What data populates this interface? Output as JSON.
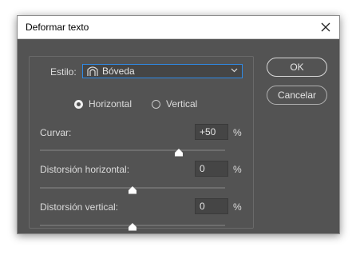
{
  "window": {
    "title": "Deformar texto"
  },
  "style": {
    "label": "Estilo:",
    "value": "Bóveda"
  },
  "orientation": {
    "options": [
      {
        "label": "Horizontal",
        "selected": true
      },
      {
        "label": "Vertical",
        "selected": false
      }
    ]
  },
  "params": [
    {
      "label": "Curvar:",
      "value": "+50",
      "unit": "%",
      "level": 75
    },
    {
      "label": "Distorsión horizontal:",
      "value": "0",
      "unit": "%",
      "level": 50
    },
    {
      "label": "Distorsión vertical:",
      "value": "0",
      "unit": "%",
      "level": 50
    }
  ],
  "buttons": {
    "ok": "OK",
    "cancel": "Cancelar"
  },
  "colors": {
    "dialog_bg": "#535353",
    "focus": "#2f8ae6",
    "text": "#dcdcdc"
  },
  "icons": {
    "close": "close-icon",
    "style": "arc-warp-icon",
    "dropdown": "chevron-down-icon"
  }
}
